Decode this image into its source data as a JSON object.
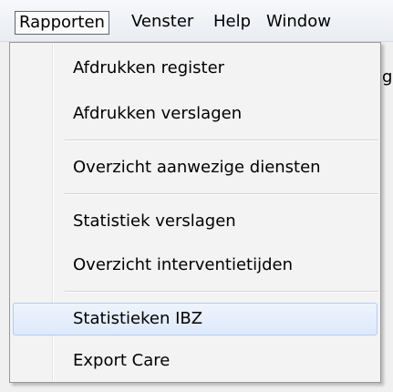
{
  "menubar": {
    "items": [
      {
        "label": "Rapporten"
      },
      {
        "label": "Venster"
      },
      {
        "label": "Help"
      },
      {
        "label": "Window"
      }
    ]
  },
  "menu": {
    "items": [
      {
        "label": "Afdrukken register"
      },
      {
        "label": "Afdrukken verslagen"
      },
      {
        "label": "Overzicht aanwezige diensten"
      },
      {
        "label": "Statistiek verslagen"
      },
      {
        "label": "Overzicht interventietijden"
      },
      {
        "label": "Statistieken IBZ"
      },
      {
        "label": "Export Care"
      }
    ]
  },
  "edge": {
    "glyph": "g"
  }
}
